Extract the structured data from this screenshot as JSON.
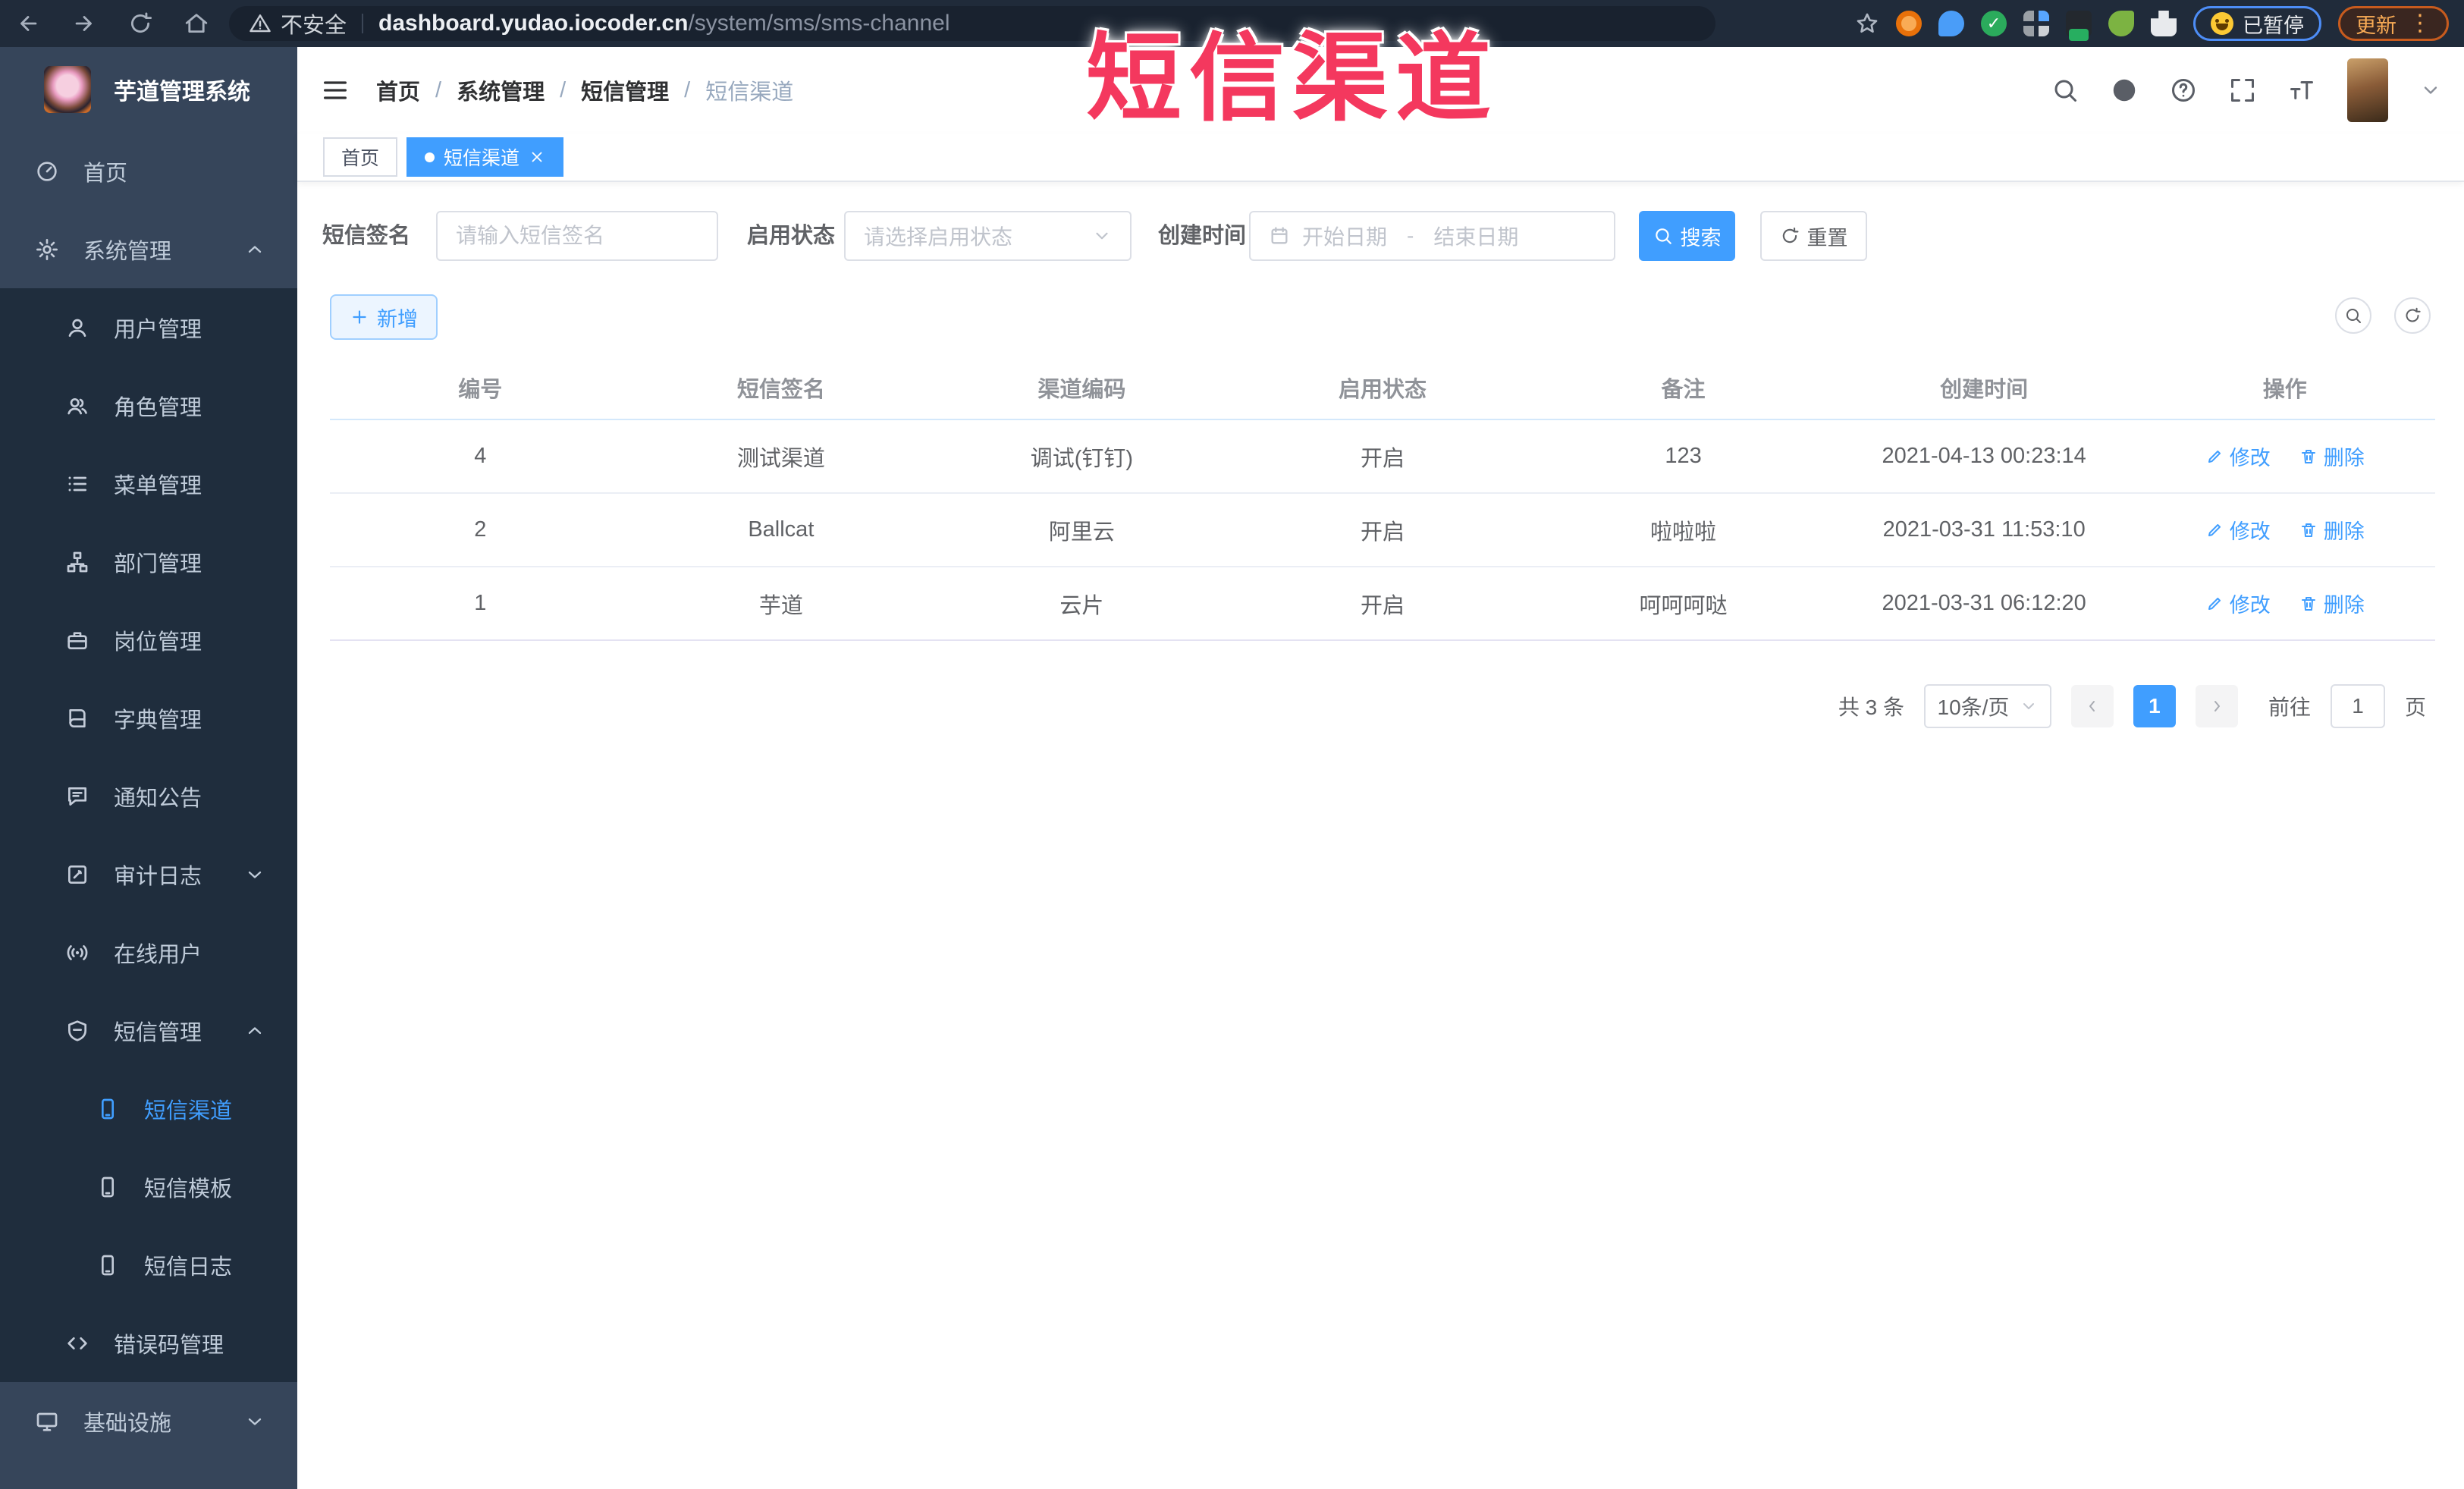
{
  "watermark": "短信渠道",
  "browser": {
    "security_label": "不安全",
    "url_host": "dashboard.yudao.iocoder.cn",
    "url_path": "/system/sms/sms-channel",
    "paused_label": "已暂停",
    "update_label": "更新"
  },
  "sidebar": {
    "title": "芋道管理系统",
    "items": [
      {
        "label": "首页"
      },
      {
        "label": "系统管理"
      },
      {
        "label": "用户管理"
      },
      {
        "label": "角色管理"
      },
      {
        "label": "菜单管理"
      },
      {
        "label": "部门管理"
      },
      {
        "label": "岗位管理"
      },
      {
        "label": "字典管理"
      },
      {
        "label": "通知公告"
      },
      {
        "label": "审计日志"
      },
      {
        "label": "在线用户"
      },
      {
        "label": "短信管理"
      },
      {
        "label": "短信渠道"
      },
      {
        "label": "短信模板"
      },
      {
        "label": "短信日志"
      },
      {
        "label": "错误码管理"
      },
      {
        "label": "基础设施"
      }
    ]
  },
  "header": {
    "breadcrumbs": [
      "首页",
      "系统管理",
      "短信管理",
      "短信渠道"
    ]
  },
  "tabs": [
    {
      "label": "首页"
    },
    {
      "label": "短信渠道"
    }
  ],
  "filters": {
    "sign_label": "短信签名",
    "sign_placeholder": "请输入短信签名",
    "status_label": "启用状态",
    "status_placeholder": "请选择启用状态",
    "time_label": "创建时间",
    "start_placeholder": "开始日期",
    "range_separator": "-",
    "end_placeholder": "结束日期",
    "search_label": "搜索",
    "reset_label": "重置"
  },
  "toolbar": {
    "add_label": "新增"
  },
  "table": {
    "columns": [
      "编号",
      "短信签名",
      "渠道编码",
      "启用状态",
      "备注",
      "创建时间",
      "操作"
    ],
    "edit_label": "修改",
    "delete_label": "删除",
    "rows": [
      {
        "id": "4",
        "sign": "测试渠道",
        "code": "调试(钉钉)",
        "status": "开启",
        "remark": "123",
        "create_time": "2021-04-13 00:23:14"
      },
      {
        "id": "2",
        "sign": "Ballcat",
        "code": "阿里云",
        "status": "开启",
        "remark": "啦啦啦",
        "create_time": "2021-03-31 11:53:10"
      },
      {
        "id": "1",
        "sign": "芋道",
        "code": "云片",
        "status": "开启",
        "remark": "呵呵呵哒",
        "create_time": "2021-03-31 06:12:20"
      }
    ]
  },
  "pagination": {
    "total_label": "共 3 条",
    "page_size": "10条/页",
    "current_page": "1",
    "goto_label": "前往",
    "goto_value": "1",
    "page_unit": "页"
  }
}
